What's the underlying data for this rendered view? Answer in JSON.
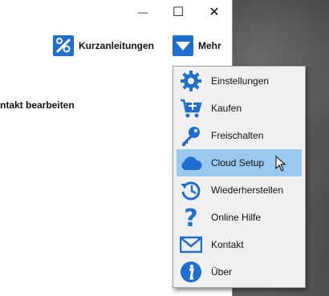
{
  "window_controls": {
    "minimize": "—",
    "maximize": "☐",
    "close": "✕"
  },
  "toolbar": {
    "quickguide_label": "Kurzanleitungen",
    "quickguide_icon": "tools-icon",
    "more_label": "Mehr",
    "more_icon": "chevron-down-icon"
  },
  "main": {
    "heading": "ntakt bearbeiten"
  },
  "menu": {
    "items": [
      {
        "label": "Einstellungen",
        "icon": "gear-icon"
      },
      {
        "label": "Kaufen",
        "icon": "cart-icon"
      },
      {
        "label": "Freischalten",
        "icon": "key-icon"
      },
      {
        "label": "Cloud Setup",
        "icon": "cloud-icon",
        "highlighted": true
      },
      {
        "label": "Wiederherstellen",
        "icon": "history-icon"
      },
      {
        "label": "Online Hilfe",
        "icon": "question-icon"
      },
      {
        "label": "Kontakt",
        "icon": "mail-icon"
      },
      {
        "label": "Über",
        "icon": "info-icon"
      }
    ]
  },
  "colors": {
    "accent": "#1f6fd0",
    "highlight": "#99c9ef",
    "menu_bg": "#f0f0f0"
  }
}
